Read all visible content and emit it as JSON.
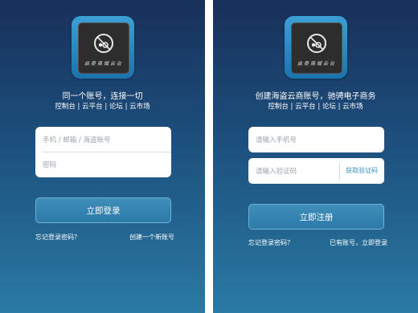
{
  "login": {
    "logo_text": "启奇商城云台",
    "tagline": "同一个账号，连接一切",
    "links": "控制台 | 云平台 | 论坛 | 云市场",
    "username_placeholder": "手机 / 邮箱 / 海盗账号",
    "password_placeholder": "密码",
    "login_button": "立即登录",
    "forgot_link": "忘记登录密码？",
    "create_link": "创建一个新账号"
  },
  "register": {
    "logo_text": "启奇商城云台",
    "tagline": "创建海盗云商账号，驰骋电子商务",
    "links": "控制台 | 云平台 | 论坛 | 云市场",
    "phone_placeholder": "请输入手机号",
    "code_placeholder": "请输入验证码",
    "get_code_button": "获取验证码",
    "register_button": "立即注册",
    "forgot_link": "忘记登录密码？",
    "have_account_link": "已有账号，立即登录"
  },
  "colors": {
    "background_top": "#18305a",
    "background_bottom": "#2a7aa4",
    "logo_frame": "#2a8cc8",
    "link_accent": "#3b91c7"
  },
  "icons": [
    "app-logo-icon"
  ]
}
